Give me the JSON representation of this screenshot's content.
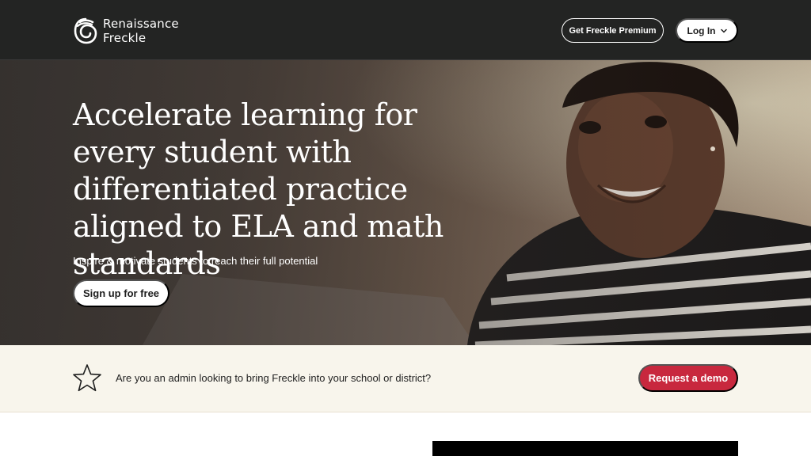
{
  "header": {
    "logo_line1": "Renaissance",
    "logo_line2": "Freckle",
    "premium_label": "Get Freckle Premium",
    "login_label": "Log In"
  },
  "hero": {
    "title": "Accelerate learning for every student with differentiated practice aligned to ELA and math standards",
    "subtitle": "Inspire & motivate students to reach their full potential",
    "cta_label": "Sign up for free"
  },
  "admin_banner": {
    "icon": "star-icon",
    "text": "Are you an admin looking to bring Freckle into your school or district?",
    "cta_label": "Request a demo"
  },
  "colors": {
    "header_bg": "#232423",
    "banner_bg": "#f8f5ec",
    "demo_button": "#c8283e"
  }
}
